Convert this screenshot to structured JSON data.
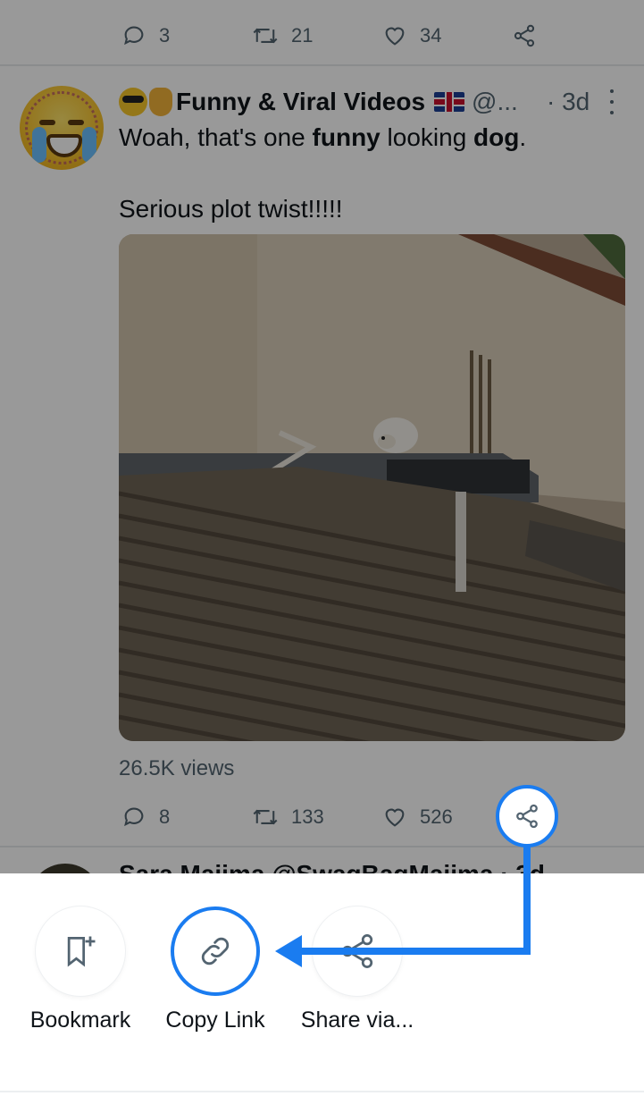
{
  "prev_tweet": {
    "reply_count": "3",
    "retweet_count": "21",
    "like_count": "34"
  },
  "tweet": {
    "author_name": "Funny & Viral Videos",
    "handle": "@...",
    "time_sep": "·",
    "time": "3d",
    "text_line1_pre": "Woah, that's one ",
    "text_line1_b1": "funny",
    "text_line1_mid": " looking ",
    "text_line1_b2": "dog",
    "text_line1_post": ".",
    "text_line2": "Serious plot twist!!!!!",
    "views": "26.5K views",
    "reply_count": "8",
    "retweet_count": "133",
    "like_count": "526"
  },
  "next_tweet": {
    "author_name": "Sara Majima @SwagBagMajima · 3d"
  },
  "share_sheet": {
    "bookmark_label": "Bookmark",
    "copy_link_label": "Copy Link",
    "share_via_label": "Share via..."
  },
  "colors": {
    "annotation": "#1a7cf0",
    "icon_gray": "#536471"
  }
}
